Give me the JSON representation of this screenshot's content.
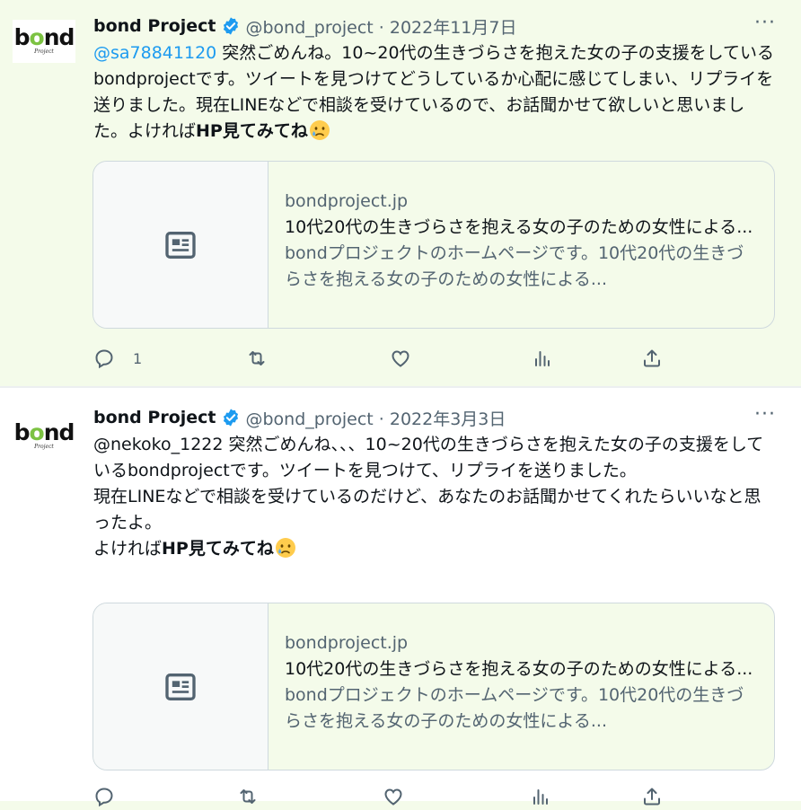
{
  "tweets": [
    {
      "name": "bond Project",
      "handle": "@bond_project · 2022年11月7日",
      "avatar_word_a": "b",
      "avatar_word_o": "o",
      "avatar_word_b": "nd",
      "avatar_sub": "Project",
      "mention": "@sa78841120",
      "text_1": " 突然ごめんね。10~20代の生きづらさを抱えた女の子の支援をしているbondprojectです。ツイートを見つけてどうしているか心配に感じてしまい、リプライを送りました。現在LINEなどで相談を受けているので、お話聞かせて欲しいと思いました。よければ",
      "bold_text": "HP見てみてね",
      "card": {
        "domain": "bondproject.jp",
        "title": "10代20代の生きづらさを抱える女の子のための女性による...",
        "desc": "bondプロジェクトのホームページです。10代20代の生きづらさを抱える女の子のための女性による..."
      },
      "reply_count": "1"
    },
    {
      "name": "bond Project",
      "handle": "@bond_project · 2022年3月3日",
      "avatar_word_a": "b",
      "avatar_word_o": "o",
      "avatar_word_b": "nd",
      "avatar_sub": "Project",
      "mention": "@nekoko_1222",
      "text_1": " 突然ごめんね、、、10~20代の生きづらさを抱えた女の子の支援をしているbondprojectです。ツイートを見つけて、リプライを送りました。",
      "text_2": "現在LINEなどで相談を受けているのだけど、あなたのお話聞かせてくれたらいいなと思ったよ。",
      "text_3": "よければ",
      "bold_text": "HP見てみてね",
      "card": {
        "domain": "bondproject.jp",
        "title": "10代20代の生きづらさを抱える女の子のための女性による...",
        "desc": "bondプロジェクトのホームページです。10代20代の生きづらさを抱える女の子のための女性による..."
      }
    }
  ],
  "icons": {
    "verified": "verified-badge-icon",
    "more": "more-options-icon",
    "reply": "reply-icon",
    "retweet": "retweet-icon",
    "like": "like-icon",
    "views": "views-icon",
    "share": "share-icon",
    "card_placeholder": "article-icon",
    "emoji": "crying-face-emoji"
  },
  "colors": {
    "link": "#1d9bf0",
    "verified": "#1d9bf0",
    "secondary_text": "#536471",
    "logo_accent": "#7cc242"
  },
  "more_label": "···"
}
